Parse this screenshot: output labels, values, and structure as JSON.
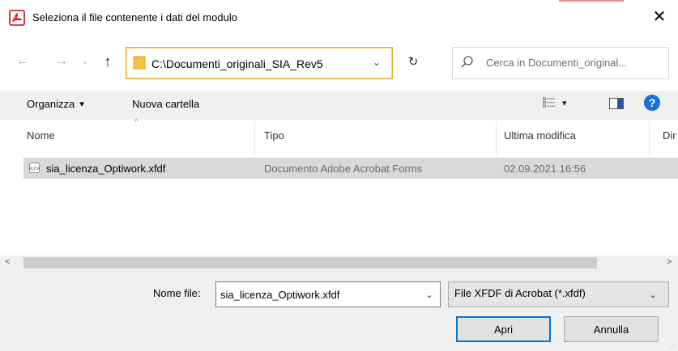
{
  "window": {
    "title": "Seleziona il file contenente i dati del modulo",
    "close_glyph": "✕",
    "app_icon": "acrobat-icon",
    "accent_color": "#c80a0a"
  },
  "nav": {
    "back_glyph": "←",
    "forward_glyph": "→",
    "recent_glyph": "⌄",
    "up_glyph": "↑",
    "address": "C:\\Documenti_originali_SIA_Rev5",
    "address_dropdown_glyph": "⌄",
    "refresh_glyph": "↻",
    "search_placeholder": "Cerca in Documenti_original..."
  },
  "toolbar": {
    "organize_label": "Organizza",
    "organize_caret": "▾",
    "new_folder_label": "Nuova cartella",
    "view_caret": "▾",
    "help_glyph": "?"
  },
  "columns": {
    "name": "Nome",
    "type": "Tipo",
    "modified": "Ultima modifica",
    "dir": "Dir",
    "sort_glyph": "^"
  },
  "files": [
    {
      "name": "sia_licenza_Optiwork.xfdf",
      "type": "Documento Adobe Acrobat Forms",
      "modified": "02.09.2021 16:56"
    }
  ],
  "scroll": {
    "left_glyph": "<",
    "right_glyph": ">"
  },
  "bottom": {
    "filename_label": "Nome file:",
    "filename_value": "sia_licenza_Optiwork.xfdf",
    "filename_dropdown_glyph": "⌄",
    "filetype_value": "File XFDF di Acrobat (*.xfdf)",
    "filetype_dropdown_glyph": "⌄",
    "open_label": "Apri",
    "cancel_label": "Annulla",
    "primary_color": "#0078d7"
  }
}
